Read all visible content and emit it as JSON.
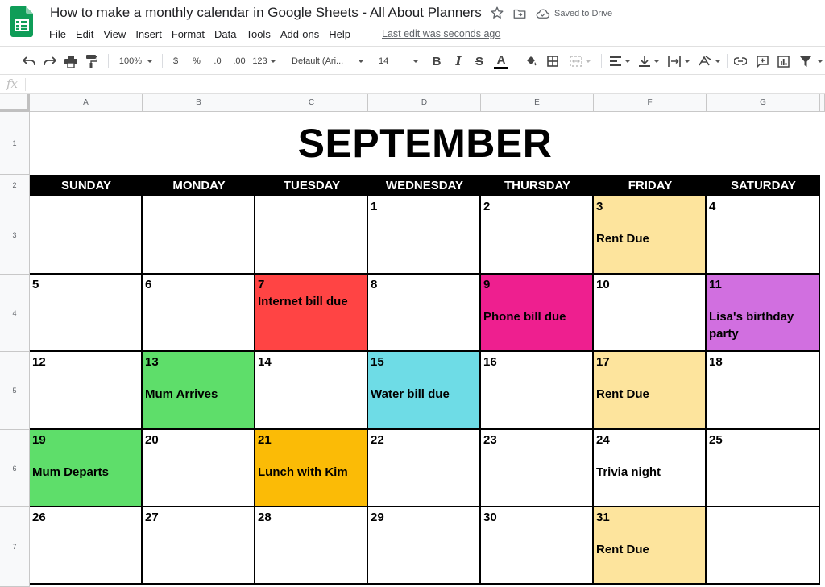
{
  "header": {
    "title": "How to make a monthly calendar in Google Sheets - All About Planners",
    "saved_status": "Saved to Drive",
    "last_edit": "Last edit was seconds ago"
  },
  "menu": [
    "File",
    "Edit",
    "View",
    "Insert",
    "Format",
    "Data",
    "Tools",
    "Add-ons",
    "Help"
  ],
  "toolbar": {
    "zoom": "100%",
    "currency": "$",
    "percent": "%",
    "decrease_decimals": ".0",
    "increase_decimals": ".00",
    "more_formats": "123",
    "font": "Default (Ari...",
    "font_size": "14",
    "bold": "B",
    "italic": "I",
    "strikethrough": "S",
    "text_color": "A"
  },
  "formula_bar": {
    "fx": "fx",
    "value": ""
  },
  "columns": [
    "A",
    "B",
    "C",
    "D",
    "E",
    "F",
    "G"
  ],
  "rows": [
    "1",
    "2",
    "3",
    "4",
    "5",
    "6",
    "7"
  ],
  "calendar": {
    "month": "SEPTEMBER",
    "days": [
      "SUNDAY",
      "MONDAY",
      "TUESDAY",
      "WEDNESDAY",
      "THURSDAY",
      "FRIDAY",
      "SATURDAY"
    ],
    "weeks": [
      [
        {
          "day": "",
          "event": "",
          "color": "#ffffff"
        },
        {
          "day": "",
          "event": "",
          "color": "#ffffff"
        },
        {
          "day": "",
          "event": "",
          "color": "#ffffff"
        },
        {
          "day": "1",
          "event": "",
          "color": "#ffffff"
        },
        {
          "day": "2",
          "event": "",
          "color": "#ffffff"
        },
        {
          "day": "3",
          "event": "Rent Due",
          "color": "#fde49d"
        },
        {
          "day": "4",
          "event": "",
          "color": "#ffffff"
        }
      ],
      [
        {
          "day": "5",
          "event": "",
          "color": "#ffffff"
        },
        {
          "day": "6",
          "event": "",
          "color": "#ffffff"
        },
        {
          "day": "7",
          "event": "Internet bill due",
          "color": "#ff4444",
          "tight": true
        },
        {
          "day": "8",
          "event": "",
          "color": "#ffffff"
        },
        {
          "day": "9",
          "event": "Phone bill due",
          "color": "#ee1f8f"
        },
        {
          "day": "10",
          "event": "",
          "color": "#ffffff"
        },
        {
          "day": "11",
          "event": "Lisa's birthday party",
          "color": "#d16fe0"
        }
      ],
      [
        {
          "day": "12",
          "event": "",
          "color": "#ffffff"
        },
        {
          "day": "13",
          "event": "Mum Arrives",
          "color": "#5ede6a"
        },
        {
          "day": "14",
          "event": "",
          "color": "#ffffff"
        },
        {
          "day": "15",
          "event": "Water bill due",
          "color": "#6edce6"
        },
        {
          "day": "16",
          "event": "",
          "color": "#ffffff"
        },
        {
          "day": "17",
          "event": "Rent Due",
          "color": "#fde49d"
        },
        {
          "day": "18",
          "event": "",
          "color": "#ffffff"
        }
      ],
      [
        {
          "day": "19",
          "event": "Mum Departs",
          "color": "#5ede6a"
        },
        {
          "day": "20",
          "event": "",
          "color": "#ffffff"
        },
        {
          "day": "21",
          "event": "Lunch with Kim",
          "color": "#fbbb06"
        },
        {
          "day": "22",
          "event": "",
          "color": "#ffffff"
        },
        {
          "day": "23",
          "event": "",
          "color": "#ffffff"
        },
        {
          "day": "24",
          "event": "Trivia night",
          "color": "#ffffff"
        },
        {
          "day": "25",
          "event": "",
          "color": "#ffffff"
        }
      ],
      [
        {
          "day": "26",
          "event": "",
          "color": "#ffffff"
        },
        {
          "day": "27",
          "event": "",
          "color": "#ffffff"
        },
        {
          "day": "28",
          "event": "",
          "color": "#ffffff"
        },
        {
          "day": "29",
          "event": "",
          "color": "#ffffff"
        },
        {
          "day": "30",
          "event": "",
          "color": "#ffffff"
        },
        {
          "day": "31",
          "event": "Rent Due",
          "color": "#fde49d"
        },
        {
          "day": "",
          "event": "",
          "color": "#ffffff"
        }
      ]
    ]
  }
}
